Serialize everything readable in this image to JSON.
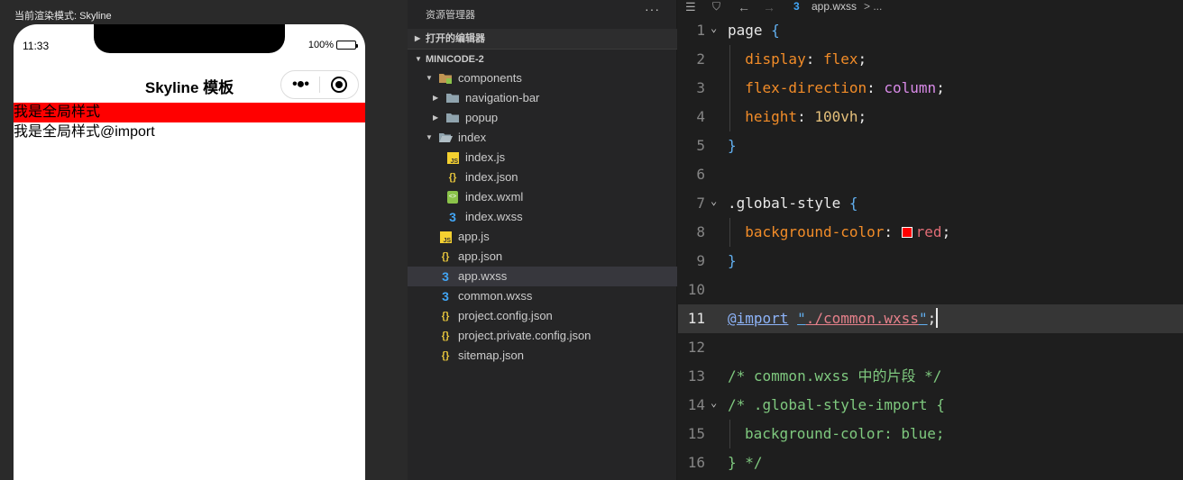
{
  "simulator": {
    "render_mode": "当前渲染模式: Skyline",
    "time": "11:33",
    "battery": "100%",
    "nav_title": "Skyline 模板",
    "global_style_text": "我是全局样式",
    "global_import_text": "我是全局样式@import",
    "global_style_bg": "#ff0000"
  },
  "explorer": {
    "title": "资源管理器",
    "more": "···",
    "open_editors": "打开的编辑器",
    "project": "MINICODE-2",
    "tree": [
      {
        "name": "components",
        "icon": "folder-components-icon"
      },
      {
        "name": "navigation-bar",
        "icon": "folder-icon"
      },
      {
        "name": "popup",
        "icon": "folder-icon"
      },
      {
        "name": "index",
        "icon": "folder-open-icon"
      },
      {
        "name": "index.js",
        "icon": "js-file-icon"
      },
      {
        "name": "index.json",
        "icon": "json-file-icon"
      },
      {
        "name": "index.wxml",
        "icon": "wxml-file-icon"
      },
      {
        "name": "index.wxss",
        "icon": "wxss-file-icon"
      },
      {
        "name": "app.js",
        "icon": "js-file-icon"
      },
      {
        "name": "app.json",
        "icon": "json-file-icon"
      },
      {
        "name": "app.wxss",
        "icon": "wxss-file-icon",
        "selected": true
      },
      {
        "name": "common.wxss",
        "icon": "wxss-file-icon"
      },
      {
        "name": "project.config.json",
        "icon": "json-file-icon"
      },
      {
        "name": "project.private.config.json",
        "icon": "json-file-icon"
      },
      {
        "name": "sitemap.json",
        "icon": "json-file-icon"
      }
    ]
  },
  "editor": {
    "breadcrumb_file": "app.wxss",
    "breadcrumb_more": "> ...",
    "current_line": 11,
    "lines": {
      "l1_sel": "page",
      "l1_brace": "{",
      "l2_prop": "display",
      "l2_val": "flex",
      "l3_prop": "flex-direction",
      "l3_val": "column",
      "l4_prop": "height",
      "l4_num": "100vh",
      "l5": "}",
      "l7_sel": ".global-style",
      "l7_brace": "{",
      "l8_prop": "background-color",
      "l8_val": "red",
      "l9": "}",
      "l11_kw": "@import",
      "l11_str": "./common.wxss",
      "l13": "/* common.wxss 中的片段 */",
      "l14": "/* .global-style-import {",
      "l15": "background-color: blue;",
      "l16": "} */"
    }
  }
}
